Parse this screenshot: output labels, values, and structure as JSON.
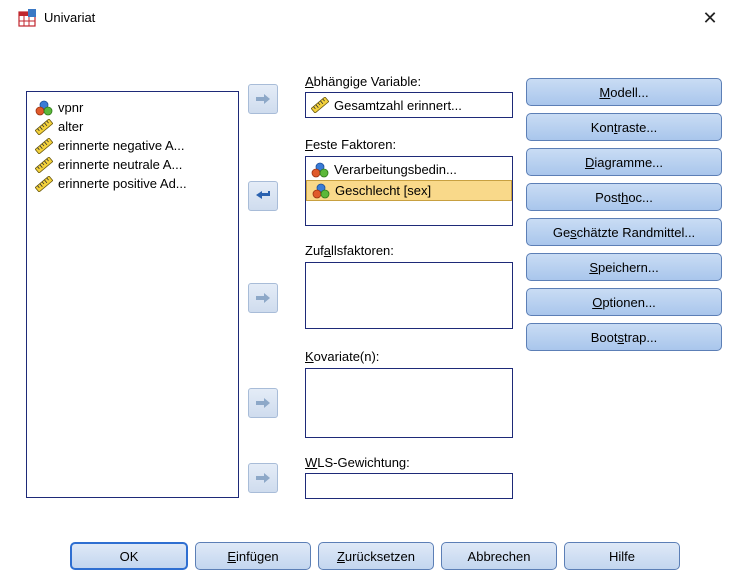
{
  "window": {
    "title": "Univariat",
    "close_glyph": "✕"
  },
  "variables": [
    {
      "label": "vpnr",
      "icon": "nominal-icon"
    },
    {
      "label": "alter",
      "icon": "scale-ruler-icon"
    },
    {
      "label": "erinnerte negative A...",
      "icon": "scale-ruler-icon"
    },
    {
      "label": "erinnerte neutrale A...",
      "icon": "scale-ruler-icon"
    },
    {
      "label": "erinnerte positive Ad...",
      "icon": "scale-ruler-icon"
    }
  ],
  "dependent": {
    "label_pre": "",
    "label_key": "A",
    "label_post": "bhängige Variable:",
    "value": "Gesamtzahl erinnert...",
    "icon": "scale-ruler-icon"
  },
  "fixed": {
    "label_key": "F",
    "label_post": "este Faktoren:",
    "items": [
      {
        "label": "Verarbeitungsbedin...",
        "icon": "nominal-icon",
        "selected": false
      },
      {
        "label": "Geschlecht [sex]",
        "icon": "nominal-icon",
        "selected": true
      }
    ]
  },
  "random": {
    "label_pre": "Zuf",
    "label_key": "a",
    "label_post": "llsfaktoren:"
  },
  "covariates": {
    "label_key": "K",
    "label_post": "ovariate(n):"
  },
  "wls": {
    "label_key": "W",
    "label_post": "LS-Gewichtung:"
  },
  "side_buttons": [
    {
      "pre": "",
      "key": "M",
      "post": "odell..."
    },
    {
      "pre": "Kon",
      "key": "t",
      "post": "raste..."
    },
    {
      "pre": "",
      "key": "D",
      "post": "iagramme..."
    },
    {
      "pre": "Post ",
      "key": "h",
      "post": "oc..."
    },
    {
      "pre": "Ge",
      "key": "s",
      "post": "chätzte Randmittel..."
    },
    {
      "pre": "",
      "key": "S",
      "post": "peichern..."
    },
    {
      "pre": "",
      "key": "O",
      "post": "ptionen..."
    },
    {
      "pre": "Boot",
      "key": "s",
      "post": "trap..."
    }
  ],
  "bottom_buttons": [
    {
      "pre": "OK",
      "key": "",
      "post": ""
    },
    {
      "pre": "",
      "key": "E",
      "post": "infügen"
    },
    {
      "pre": "",
      "key": "Z",
      "post": "urücksetzen"
    },
    {
      "pre": "Abbrechen",
      "key": "",
      "post": ""
    },
    {
      "pre": "Hilfe",
      "key": "",
      "post": ""
    }
  ]
}
